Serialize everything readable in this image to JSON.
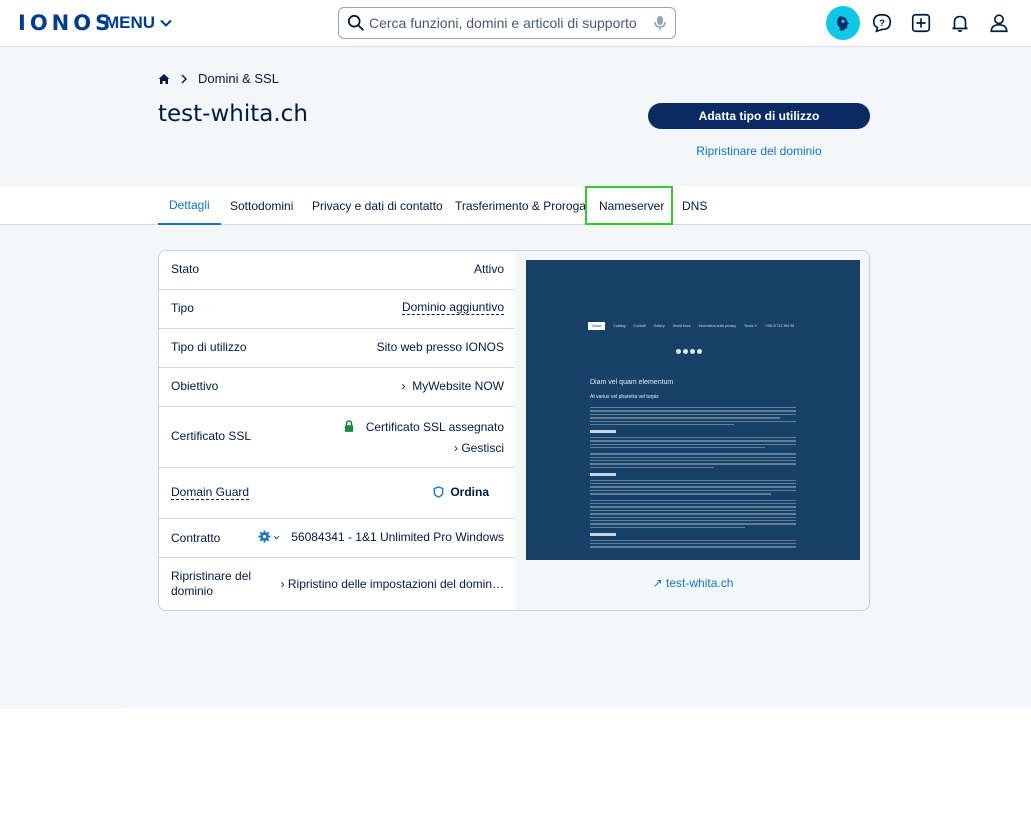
{
  "header": {
    "logo": "IONOS",
    "menu_label": "MENU",
    "search_placeholder": "Cerca funzioni, domini e articoli di supporto"
  },
  "breadcrumb": {
    "section": "Domini & SSL"
  },
  "page": {
    "title": "test-whita.ch",
    "primary_button": "Adatta tipo di utilizzo",
    "secondary_link": "Ripristinare del dominio"
  },
  "tabs": [
    {
      "label": "Dettagli",
      "active": true
    },
    {
      "label": "Sottodomini"
    },
    {
      "label": "Privacy e dati di contatto"
    },
    {
      "label": "Trasferimento & Proroga"
    },
    {
      "label": "Nameserver",
      "highlighted": true
    },
    {
      "label": "DNS"
    }
  ],
  "details": {
    "stato": {
      "label": "Stato",
      "value": "Attivo"
    },
    "tipo": {
      "label": "Tipo",
      "value": "Dominio aggiuntivo"
    },
    "utilizzo": {
      "label": "Tipo di utilizzo",
      "value": "Sito web presso IONOS"
    },
    "obiettivo": {
      "label": "Obiettivo",
      "value": "MyWebsite NOW"
    },
    "ssl": {
      "label": "Certificato SSL",
      "value": "Certificato SSL assegnato",
      "action": "Gestisci"
    },
    "guard": {
      "label": "Domain Guard",
      "action": "Ordina"
    },
    "contratto": {
      "label": "Contratto",
      "value": "56084341 - 1&1 Unlimited Pro Windows"
    },
    "ripristino": {
      "label": "Ripristinare del dominio",
      "value": "Ripristino delle impostazioni del domin…"
    }
  },
  "preview": {
    "link": "test-whita.ch",
    "nav": [
      "Home",
      "Catalog",
      "Contatti",
      "Gallery",
      "Guest book",
      "Informativa sulla privacy",
      "Terms X",
      "+351/9 712 365 98"
    ],
    "heading": "Diam vel quam elementum",
    "subheading": "At varius vel pharetra vel turpis",
    "section_title_1": "Etiam tempor",
    "section_title_2": "Eget nunc scelerisque",
    "section_title_3": "Ut tristique et egestas"
  },
  "colors": {
    "brand": "#003d8f",
    "primary": "#0b2a63",
    "link": "#1474c4",
    "highlight": "#34c934",
    "preview_bg": "#174167",
    "background": "#f4f7fa"
  }
}
